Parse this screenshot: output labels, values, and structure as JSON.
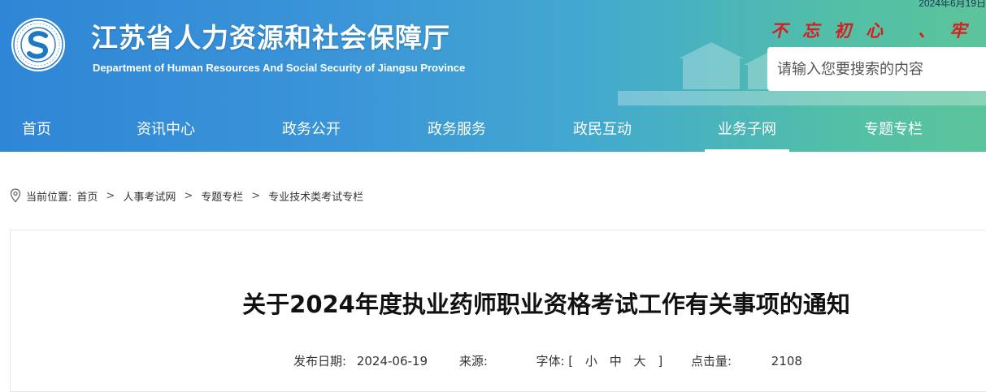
{
  "header": {
    "date_text": "2024年6月19日",
    "site_title": "江苏省人力资源和社会保障厅",
    "site_subtitle": "Department of Human Resources And Social Security of Jiangsu Province",
    "slogan": "不忘初心 、牢",
    "search_placeholder": "请输入您要搜索的内容",
    "logo_ring_text": "江苏省人力资源和社会保障厅"
  },
  "nav": {
    "items": [
      {
        "label": "首页"
      },
      {
        "label": "资讯中心"
      },
      {
        "label": "政务公开"
      },
      {
        "label": "政务服务"
      },
      {
        "label": "政民互动"
      },
      {
        "label": "业务子网",
        "active": true
      },
      {
        "label": "专题专栏"
      }
    ]
  },
  "breadcrumb": {
    "prefix": "当前位置:",
    "items": [
      "首页",
      "人事考试网",
      "专题专栏",
      "专业技术类考试专栏"
    ],
    "separator": ">"
  },
  "article": {
    "title": "关于2024年度执业药师职业资格考试工作有关事项的通知",
    "publish_label": "发布日期:",
    "publish_date": "2024-06-19",
    "source_label": "来源:",
    "source_value": "",
    "font_label": "字体:",
    "font_open": "[",
    "font_small": "小",
    "font_medium": "中",
    "font_large": "大",
    "font_close": "]",
    "views_label": "点击量:",
    "views_value": "2108"
  },
  "colors": {
    "header_gradient_start": "#2f86d6",
    "header_gradient_end": "#5cc49b",
    "slogan": "#d81e1e"
  }
}
